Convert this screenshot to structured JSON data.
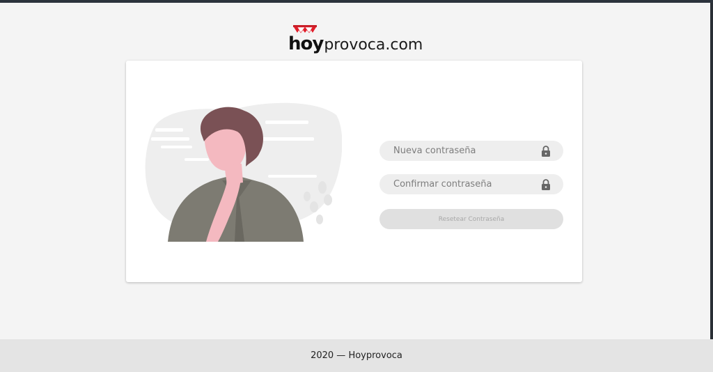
{
  "brand": {
    "logo_bold": "hoy",
    "logo_rest": "provoca.com",
    "accent_color": "#e11d2a"
  },
  "form": {
    "new_password_placeholder": "Nueva contraseña",
    "confirm_password_placeholder": "Confirmar contraseña",
    "field_icon": "lock-icon",
    "submit_label": "Resetear Contraseña",
    "submit_disabled": true
  },
  "footer": {
    "text": "2020 — Hoyprovoca"
  }
}
